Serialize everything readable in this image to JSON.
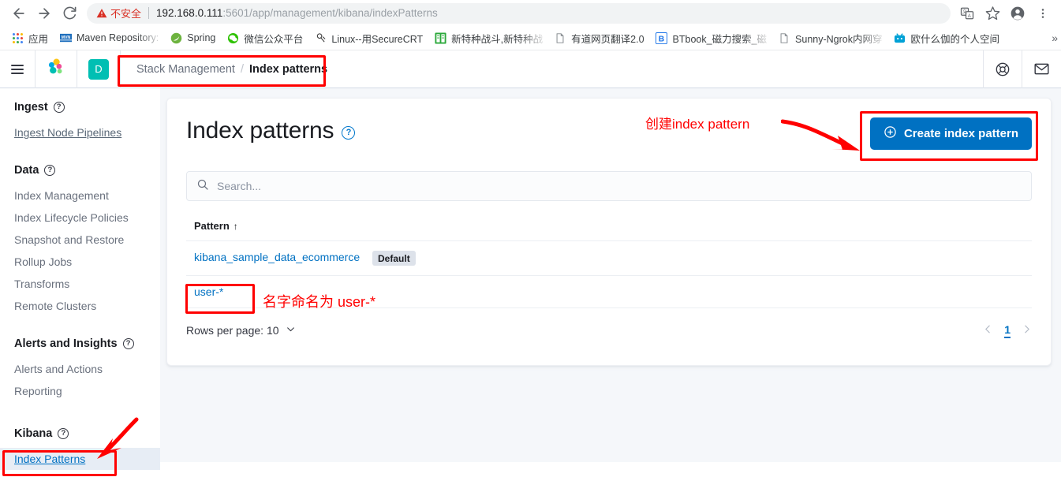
{
  "browser": {
    "nav": {
      "back": "back-arrow",
      "forward": "forward-arrow",
      "reload": "reload"
    },
    "security_label": "不安全",
    "url_host": "192.168.0.111",
    "url_rest": ":5601/app/management/kibana/indexPatterns",
    "right_icons": [
      "translate-icon",
      "bookmark-star-icon",
      "profile-avatar-icon",
      "kebab-menu-icon"
    ],
    "bookmarks": [
      {
        "label": "应用",
        "icon": "apps-grid-icon"
      },
      {
        "label": "Maven Repository:",
        "icon": "maven-icon"
      },
      {
        "label": "Spring",
        "icon": "spring-leaf-icon"
      },
      {
        "label": "微信公众平台",
        "icon": "wechat-icon"
      },
      {
        "label": "Linux--用SecureCRT",
        "icon": "securecrt-icon"
      },
      {
        "label": "新特种战斗,新特种战",
        "icon": "green-app-icon"
      },
      {
        "label": "有道网页翻译2.0",
        "icon": "page-icon"
      },
      {
        "label": "BTbook_磁力搜索_磁",
        "icon": "btbook-icon"
      },
      {
        "label": "Sunny-Ngrok内网穿",
        "icon": "page-icon"
      },
      {
        "label": "欧什么伽的个人空间",
        "icon": "bilibili-icon"
      }
    ],
    "overflow_label": "»"
  },
  "kibana_header": {
    "menu_icon": "hamburger-menu-icon",
    "logo_icon": "elastic-logo-icon",
    "space_avatar": "D",
    "breadcrumb": {
      "parent": "Stack Management",
      "separator": "/",
      "current": "Index patterns"
    },
    "right_icons": [
      "help-lifebuoy-icon",
      "mail-envelope-icon"
    ]
  },
  "sidebar": {
    "groups": [
      {
        "title": "Ingest",
        "help_icon": "question-circle-icon",
        "items": [
          {
            "label": "Ingest Node Pipelines",
            "state": "underlined"
          }
        ]
      },
      {
        "title": "Data",
        "help_icon": "question-circle-icon",
        "items": [
          {
            "label": "Index Management",
            "state": "normal"
          },
          {
            "label": "Index Lifecycle Policies",
            "state": "normal"
          },
          {
            "label": "Snapshot and Restore",
            "state": "normal"
          },
          {
            "label": "Rollup Jobs",
            "state": "normal"
          },
          {
            "label": "Transforms",
            "state": "normal"
          },
          {
            "label": "Remote Clusters",
            "state": "normal"
          }
        ]
      },
      {
        "title": "Alerts and Insights",
        "help_icon": "question-circle-icon",
        "items": [
          {
            "label": "Alerts and Actions",
            "state": "normal"
          },
          {
            "label": "Reporting",
            "state": "normal"
          }
        ]
      },
      {
        "title": "Kibana",
        "help_icon": "question-circle-icon",
        "items": [
          {
            "label": "Index Patterns",
            "state": "selected"
          }
        ]
      }
    ]
  },
  "main": {
    "title": "Index patterns",
    "title_help_icon": "question-circle-icon",
    "create_button": {
      "label": "Create index pattern",
      "icon": "plus-circle-icon",
      "color": "#0071c2"
    },
    "search": {
      "placeholder": "Search...",
      "value": "",
      "icon": "search-icon"
    },
    "table": {
      "column_header": "Pattern",
      "sort_arrow": "↑",
      "rows": [
        {
          "pattern": "kibana_sample_data_ecommerce",
          "badge": "Default"
        },
        {
          "pattern": "user-*",
          "badge": ""
        }
      ]
    },
    "footer": {
      "rows_per_page_label": "Rows per page: 10",
      "dropdown_icon": "chevron-down-icon",
      "prev_icon": "chevron-left-icon",
      "page_number": "1",
      "next_icon": "chevron-right-icon"
    }
  },
  "annotations": {
    "color": "#ff0000",
    "create_note": "创建index pattern",
    "pattern_note": "名字命名为 user-*"
  }
}
